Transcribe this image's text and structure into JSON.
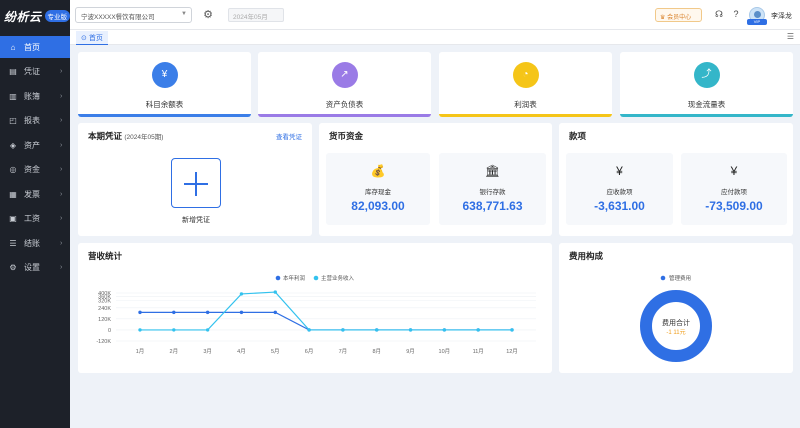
{
  "app": {
    "brand": "纷析云",
    "badge": "专业版"
  },
  "sidebar": {
    "items": [
      {
        "label": "首页",
        "icon": "home-icon",
        "glyph": "⌂",
        "arrow": ""
      },
      {
        "label": "凭证",
        "icon": "voucher-icon",
        "glyph": "▤",
        "arrow": "›"
      },
      {
        "label": "账簿",
        "icon": "ledger-icon",
        "glyph": "▥",
        "arrow": "›"
      },
      {
        "label": "报表",
        "icon": "report-icon",
        "glyph": "◰",
        "arrow": "›"
      },
      {
        "label": "资产",
        "icon": "asset-icon",
        "glyph": "◈",
        "arrow": "›"
      },
      {
        "label": "资金",
        "icon": "fund-icon",
        "glyph": "◎",
        "arrow": "›"
      },
      {
        "label": "发票",
        "icon": "invoice-icon",
        "glyph": "▦",
        "arrow": "›"
      },
      {
        "label": "工资",
        "icon": "salary-icon",
        "glyph": "▣",
        "arrow": "›"
      },
      {
        "label": "结账",
        "icon": "closing-icon",
        "glyph": "☰",
        "arrow": "›"
      },
      {
        "label": "设置",
        "icon": "settings-icon",
        "glyph": "⚙",
        "arrow": "›"
      }
    ]
  },
  "topbar": {
    "company": "宁波XXXXX餐饮有限公司",
    "period_placeholder": "2024年05月",
    "member_center": "会员中心",
    "username": "李泽龙",
    "avatar_badge": "VIP"
  },
  "tabs": {
    "home": "首页"
  },
  "reports": [
    {
      "label": "科目余额表",
      "glyph": "¥",
      "color": "#3b7ee8"
    },
    {
      "label": "资产负债表",
      "glyph": "↗",
      "color": "#9a7be6"
    },
    {
      "label": "利润表",
      "glyph": "◔",
      "color": "#f5c518"
    },
    {
      "label": "现金流量表",
      "glyph": "⤴",
      "color": "#34b6c9"
    }
  ],
  "voucher": {
    "title": "本期凭证",
    "period": "(2024年05期)",
    "view_link": "查看凭证",
    "add_label": "新增凭证"
  },
  "funds": {
    "title": "货币资金",
    "cash": {
      "label": "库存现金",
      "value": "82,093.00"
    },
    "bank": {
      "label": "银行存款",
      "value": "638,771.63"
    }
  },
  "payments": {
    "title": "款项",
    "receivable": {
      "label": "应收款项",
      "value": "-3,631.00"
    },
    "payable": {
      "label": "应付款项",
      "value": "-73,509.00"
    }
  },
  "revenue": {
    "title": "营收统计"
  },
  "expense": {
    "title": "费用构成"
  },
  "colors": {
    "accent": "#2f6fe4",
    "profit": "#2f6fe4",
    "income": "#33c2ee"
  },
  "chart_data": [
    {
      "type": "line",
      "title": "营收统计",
      "categories": [
        "1月",
        "2月",
        "3月",
        "4月",
        "5月",
        "6月",
        "7月",
        "8月",
        "9月",
        "10月",
        "11月",
        "12月"
      ],
      "series": [
        {
          "name": "本年利润",
          "values": [
            190000,
            190000,
            190000,
            190000,
            190000,
            0,
            0,
            0,
            0,
            0,
            0,
            0
          ]
        },
        {
          "name": "主营业务收入",
          "values": [
            0,
            0,
            0,
            390000,
            410000,
            0,
            0,
            0,
            0,
            0,
            0,
            0
          ]
        }
      ],
      "yticks": [
        "400K",
        "360K",
        "320K",
        "240K",
        "120K",
        "0",
        "-120K"
      ],
      "ylim": [
        -120000,
        400000
      ],
      "grid": true,
      "legend": "top-center"
    },
    {
      "type": "pie",
      "title": "费用构成",
      "legend_entries": [
        "管理费用"
      ],
      "values": [
        1
      ],
      "center_label": "费用合计",
      "center_value": "-1 11元"
    }
  ]
}
